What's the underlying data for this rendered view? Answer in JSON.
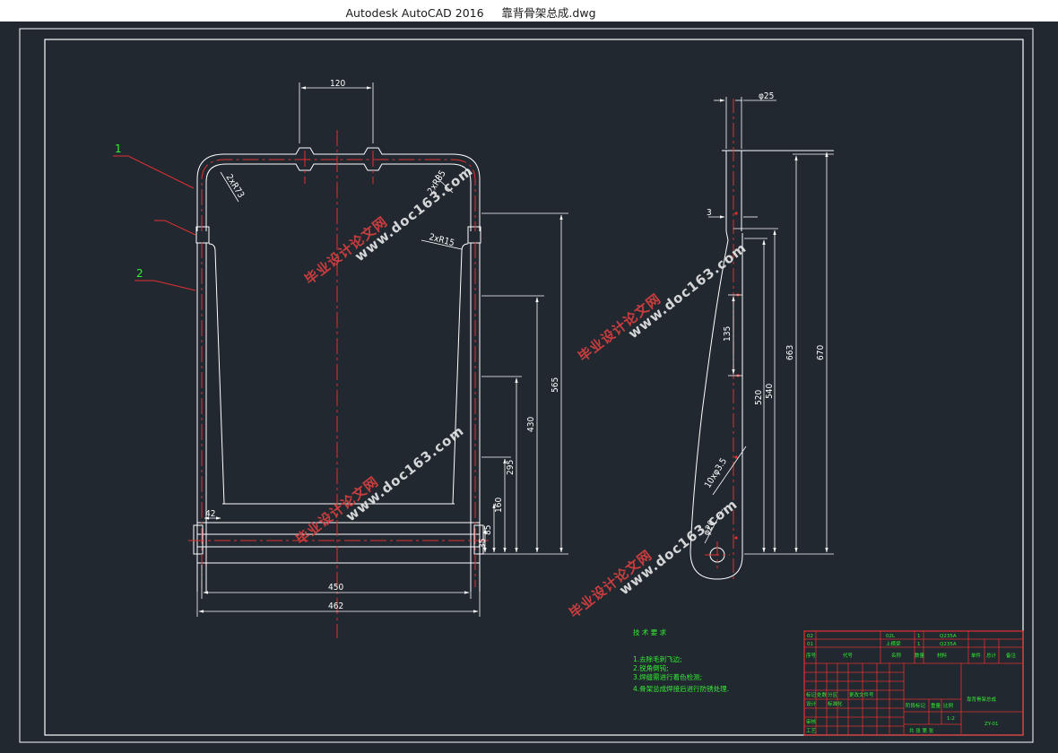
{
  "window": {
    "title": "Autodesk AutoCAD 2016     靠背骨架总成.dwg"
  },
  "drawing": {
    "front_dims": {
      "top_width": "120",
      "width_inner": "450",
      "width_outer": "462",
      "left_step": "42",
      "h1": "565",
      "h2": "430",
      "h3": "295",
      "h4": "160",
      "h5": "85",
      "h6": "35",
      "radius1": "2xR73",
      "radius2": "2xR85",
      "radius3": "2xR15"
    },
    "side_dims": {
      "dia_top": "φ25",
      "gap": "3",
      "h135": "135",
      "h520": "520",
      "h540": "540",
      "h663": "663",
      "h670": "670",
      "holes": "10xφ3.5",
      "dia_bottom": "φ20"
    },
    "balloons": [
      "1",
      "2"
    ],
    "watermark_cn": "毕业设计论文网",
    "watermark_url": "www.doc163.com"
  },
  "notes": {
    "title": "技 术 要 求",
    "items": [
      "1.去除毛刺飞边;",
      "2.锐角倒钝;",
      "3.焊缝需进行着色检测;",
      "4.骨架总成焊接后进行防锈处理."
    ]
  },
  "title_block": {
    "drawing_name": "靠背骨架总成",
    "drawing_no": "ZY-01",
    "scale": "1:2",
    "rows": [
      {
        "no": "02",
        "code": "02L",
        "qty": "1",
        "material": "Q235A"
      },
      {
        "no": "01",
        "code": "上横梁",
        "qty": "1",
        "material": "Q235A"
      }
    ],
    "headers": [
      "序号",
      "代号",
      "名称",
      "数量",
      "材料",
      "单件",
      "总计",
      "备注"
    ],
    "sign_labels": [
      "标记",
      "处数",
      "分区",
      "更改文件号",
      "签名",
      "年月日",
      "设计",
      "标准化",
      "阶段标记",
      "重量",
      "比例",
      "审核",
      "工艺",
      "批准",
      "共 张 第 张"
    ]
  }
}
